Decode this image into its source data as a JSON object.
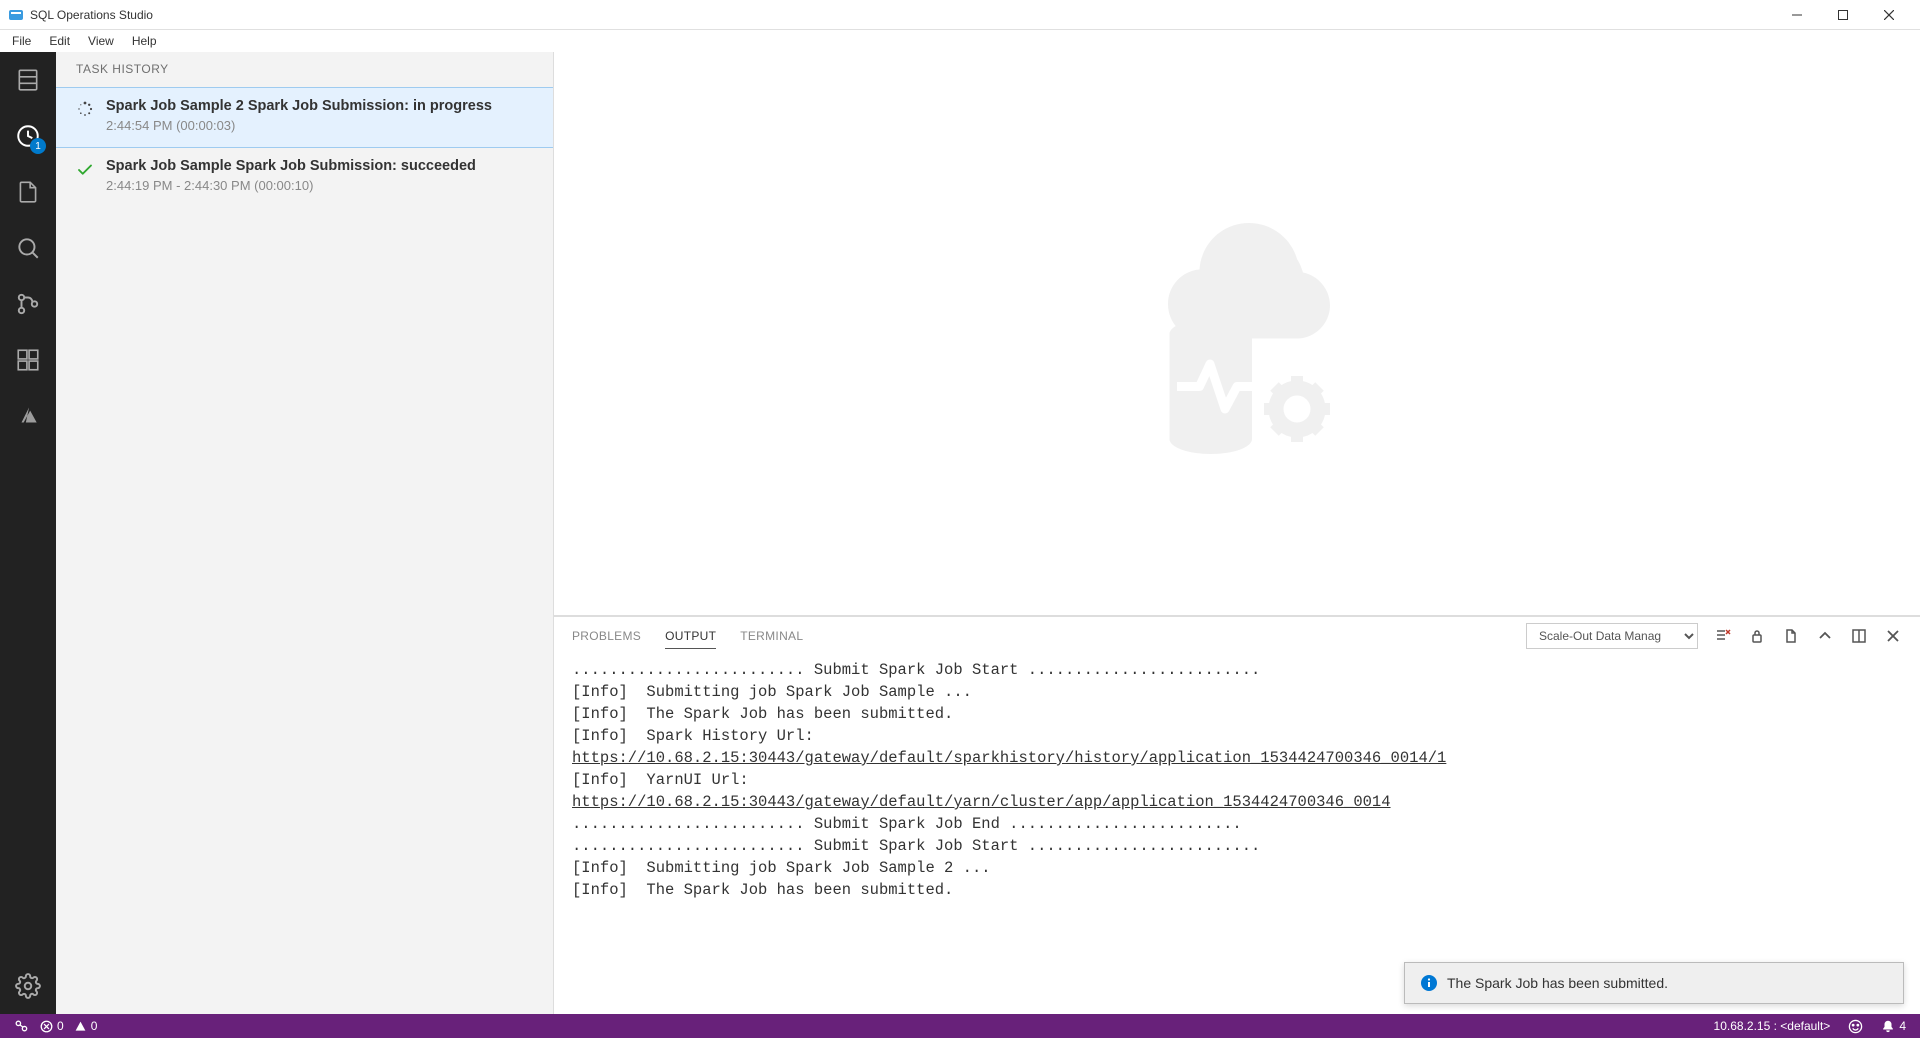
{
  "window": {
    "title": "SQL Operations Studio"
  },
  "menu": {
    "items": [
      "File",
      "Edit",
      "View",
      "Help"
    ]
  },
  "activity": {
    "badge": "1"
  },
  "sidebar": {
    "header": "TASK HISTORY",
    "tasks": [
      {
        "title": "Spark Job Sample 2 Spark Job Submission: in progress",
        "sub": "2:44:54 PM (00:00:03)",
        "status": "in_progress"
      },
      {
        "title": "Spark Job Sample Spark Job Submission: succeeded",
        "sub": "2:44:19 PM - 2:44:30 PM (00:00:10)",
        "status": "succeeded"
      }
    ]
  },
  "panel": {
    "tabs": {
      "problems": "PROBLEMS",
      "output": "OUTPUT",
      "terminal": "TERMINAL"
    },
    "select": "Scale-Out Data Manag",
    "output": {
      "line1": "......................... Submit Spark Job Start .........................",
      "line2": "[Info]  Submitting job Spark Job Sample ...",
      "line3": "[Info]  The Spark Job has been submitted.",
      "line4": "[Info]  Spark History Url:",
      "line5": "https://10.68.2.15:30443/gateway/default/sparkhistory/history/application_1534424700346_0014/1",
      "line6": "[Info]  YarnUI Url:",
      "line7": "https://10.68.2.15:30443/gateway/default/yarn/cluster/app/application_1534424700346_0014",
      "line8": "......................... Submit Spark Job End .........................",
      "line9": "......................... Submit Spark Job Start .........................",
      "line10": "[Info]  Submitting job Spark Job Sample 2 ...",
      "line11": "[Info]  The Spark Job has been submitted."
    }
  },
  "toast": {
    "message": "The Spark Job has been submitted."
  },
  "status": {
    "errors": "0",
    "warnings": "0",
    "connection": "10.68.2.15 : <default>",
    "notifications": "4"
  }
}
